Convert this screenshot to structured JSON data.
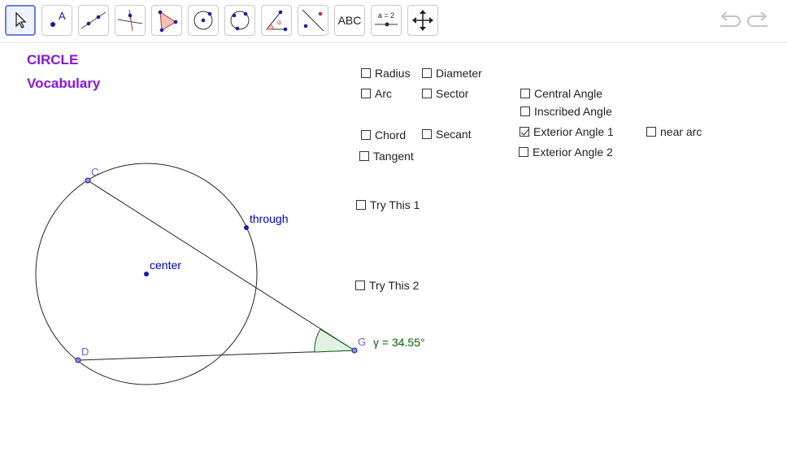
{
  "toolbar": {
    "tools": [
      {
        "name": "move-tool",
        "label": ""
      },
      {
        "name": "point-tool",
        "label": "A"
      },
      {
        "name": "line-tool",
        "label": ""
      },
      {
        "name": "perpendicular-line-tool",
        "label": ""
      },
      {
        "name": "polygon-tool",
        "label": ""
      },
      {
        "name": "circle-center-point-tool",
        "label": ""
      },
      {
        "name": "circle-three-points-tool",
        "label": ""
      },
      {
        "name": "angle-tool",
        "label": ""
      },
      {
        "name": "reflect-tool",
        "label": ""
      },
      {
        "name": "text-tool",
        "label": "ABC"
      },
      {
        "name": "slider-tool",
        "label": "a = 2"
      },
      {
        "name": "move-graphics-view-tool",
        "label": ""
      }
    ]
  },
  "title": {
    "line1": "CIRCLE",
    "line2": "Vocabulary"
  },
  "checkboxes": {
    "radius": {
      "label": "Radius",
      "checked": false
    },
    "diameter": {
      "label": "Diameter",
      "checked": false
    },
    "arc": {
      "label": "Arc",
      "checked": false
    },
    "sector": {
      "label": "Sector",
      "checked": false
    },
    "central_angle": {
      "label": "Central Angle",
      "checked": false
    },
    "inscribed_angle": {
      "label": "Inscribed Angle",
      "checked": false
    },
    "chord": {
      "label": "Chord",
      "checked": false
    },
    "secant": {
      "label": "Secant",
      "checked": false
    },
    "exterior_angle_1": {
      "label": "Exterior Angle 1",
      "checked": true
    },
    "near_arc": {
      "label": "near arc",
      "checked": false
    },
    "tangent": {
      "label": "Tangent",
      "checked": false
    },
    "exterior_angle_2": {
      "label": "Exterior Angle 2",
      "checked": false
    },
    "try_this_1": {
      "label": "Try This 1",
      "checked": false
    },
    "try_this_2": {
      "label": "Try This 2",
      "checked": false
    }
  },
  "geometry": {
    "point_c_label": "C",
    "point_d_label": "D",
    "point_g_label": "G",
    "through_label": "through",
    "center_label": "center",
    "angle_label": "γ = 34.55°",
    "colors": {
      "point_fill": "#1a1aa6",
      "point_label": "#6666cc",
      "text_blue": "#0000b0",
      "angle_text": "#006400",
      "angle_fill": "#e4efe4",
      "angle_stroke": "#006400",
      "title_purple": "#8a16d8"
    }
  }
}
